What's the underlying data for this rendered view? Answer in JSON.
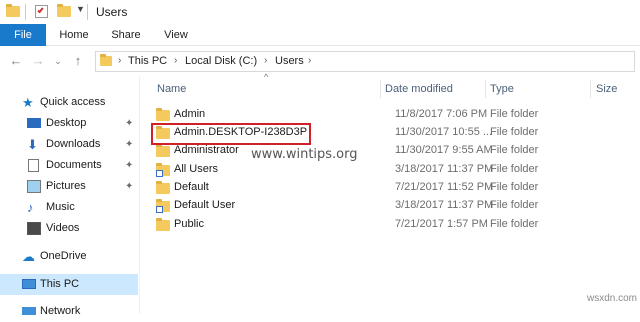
{
  "window": {
    "title": "Users"
  },
  "ribbon": {
    "tabs": [
      "File",
      "Home",
      "Share",
      "View"
    ]
  },
  "address": {
    "crumbs": [
      "This PC",
      "Local Disk (C:)",
      "Users"
    ]
  },
  "nav": {
    "items": [
      {
        "label": "Quick access",
        "icon": "star-icon",
        "pinned": false
      },
      {
        "label": "Desktop",
        "icon": "desktop-icon",
        "pinned": true
      },
      {
        "label": "Downloads",
        "icon": "download-icon",
        "pinned": true
      },
      {
        "label": "Documents",
        "icon": "documents-icon",
        "pinned": true
      },
      {
        "label": "Pictures",
        "icon": "pictures-icon",
        "pinned": true
      },
      {
        "label": "Music",
        "icon": "music-icon",
        "pinned": false
      },
      {
        "label": "Videos",
        "icon": "videos-icon",
        "pinned": false
      },
      {
        "label": "OneDrive",
        "icon": "cloud-icon",
        "pinned": false
      },
      {
        "label": "This PC",
        "icon": "computer-icon",
        "pinned": false,
        "selected": true
      },
      {
        "label": "Network",
        "icon": "network-icon",
        "pinned": false
      }
    ]
  },
  "list": {
    "columns": {
      "name": "Name",
      "date": "Date modified",
      "type": "Type",
      "size": "Size"
    },
    "rows": [
      {
        "name": "Admin",
        "date": "11/8/2017 7:06 PM",
        "type": "File folder",
        "shortcut": false
      },
      {
        "name": "Admin.DESKTOP-I238D3P",
        "date": "11/30/2017 10:55 ...",
        "type": "File folder",
        "shortcut": false
      },
      {
        "name": "Administrator",
        "date": "11/30/2017 9:55 AM",
        "type": "File folder",
        "shortcut": false
      },
      {
        "name": "All Users",
        "date": "3/18/2017 11:37 PM",
        "type": "File folder",
        "shortcut": true
      },
      {
        "name": "Default",
        "date": "7/21/2017 11:52 PM",
        "type": "File folder",
        "shortcut": false
      },
      {
        "name": "Default User",
        "date": "3/18/2017 11:37 PM",
        "type": "File folder",
        "shortcut": true
      },
      {
        "name": "Public",
        "date": "7/21/2017 1:57 PM",
        "type": "File folder",
        "shortcut": false
      }
    ]
  },
  "watermark": "www.wintips.org",
  "corner_mark": "wsxdn.com",
  "colors": {
    "accent": "#1979ca",
    "selection": "#cce8ff",
    "folder": "#f4c95d",
    "highlight_box": "#d0202a"
  }
}
